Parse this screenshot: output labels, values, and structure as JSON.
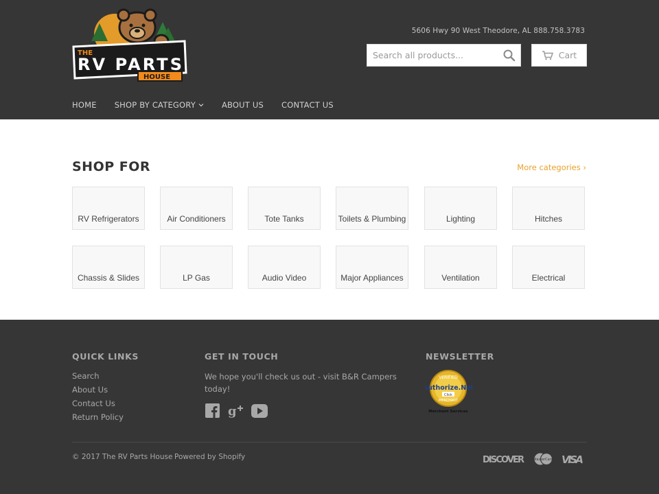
{
  "header": {
    "logo_text": "THE RV PARTS HOUSE",
    "address": "5606 Hwy 90 West Theodore, AL 888.758.3783",
    "search_placeholder": "Search all products...",
    "cart_label": "Cart"
  },
  "nav": [
    {
      "label": "HOME"
    },
    {
      "label": "SHOP BY CATEGORY",
      "dropdown": true
    },
    {
      "label": "ABOUT US"
    },
    {
      "label": "CONTACT US"
    }
  ],
  "main": {
    "title": "SHOP FOR",
    "more_link": "More categories ›",
    "categories": [
      "RV Refrigerators",
      "Air Conditioners",
      "Tote Tanks",
      "Toilets & Plumbing",
      "Lighting",
      "Hitches",
      "Chassis & Slides",
      "LP Gas",
      "Audio Video",
      "Major Appliances",
      "Ventilation",
      "Electrical"
    ]
  },
  "footer": {
    "quick_links_title": "QUICK LINKS",
    "quick_links": [
      "Search",
      "About Us",
      "Contact Us",
      "Return Policy"
    ],
    "touch_title": "GET IN TOUCH",
    "touch_text": "We hope you'll check us out - visit B&R Campers today!",
    "newsletter_title": "NEWSLETTER",
    "badge_text": "Authorize.Net",
    "copyright": "© 2017 The RV Parts House",
    "powered": "Powered by Shopify",
    "payment_methods": [
      "discover-icon",
      "mastercard-icon",
      "visa-icon"
    ]
  },
  "colors": {
    "header_bg": "#363636",
    "accent": "#e8a22c"
  }
}
